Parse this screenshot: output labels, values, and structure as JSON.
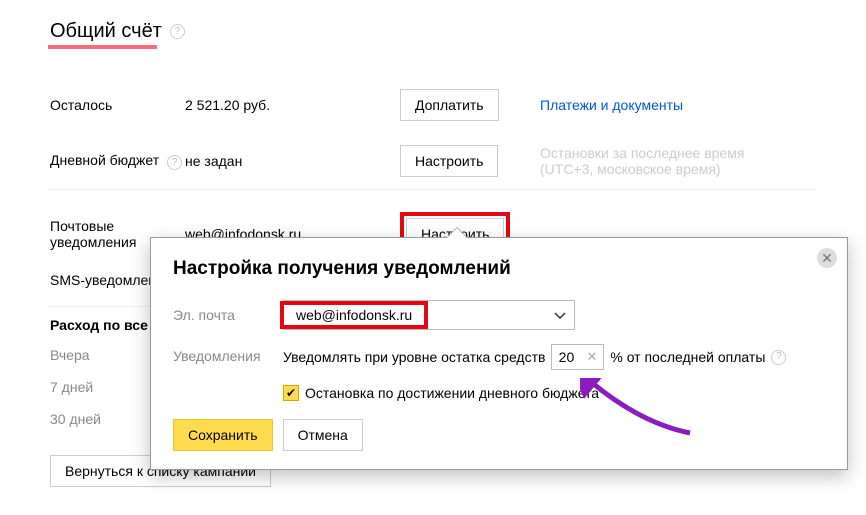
{
  "header": {
    "title": "Общий счёт"
  },
  "balance": {
    "label": "Осталось",
    "value": "2 521.20 руб.",
    "button": "Доплатить",
    "aside": "Платежи и документы"
  },
  "daily": {
    "label": "Дневной бюджет",
    "value": "не задан",
    "button": "Настроить",
    "aside_line1": "Остановки за последнее время",
    "aside_line2": "(UTC+3, московское время)"
  },
  "mail": {
    "label": "Почтовые уведомления",
    "value": "web@infodonsk.ru",
    "button": "Настроить"
  },
  "sms": {
    "label": "SMS-уведомления"
  },
  "spend": {
    "title": "Расход по все",
    "r1": "Вчера",
    "r2": "7 дней",
    "r3": "30 дней"
  },
  "back": "Вернуться к списку кампаний",
  "dialog": {
    "title": "Настройка получения уведомлений",
    "email_label": "Эл. почта",
    "email_value": "web@infodonsk.ru",
    "notif_label": "Уведомления",
    "notif_text_before": "Уведомлять при уровне остатка средств",
    "notif_value": "20",
    "notif_text_after": "% от последней оплаты",
    "checkbox_label": "Остановка по достижении дневного бюджета",
    "save": "Сохранить",
    "cancel": "Отмена"
  }
}
